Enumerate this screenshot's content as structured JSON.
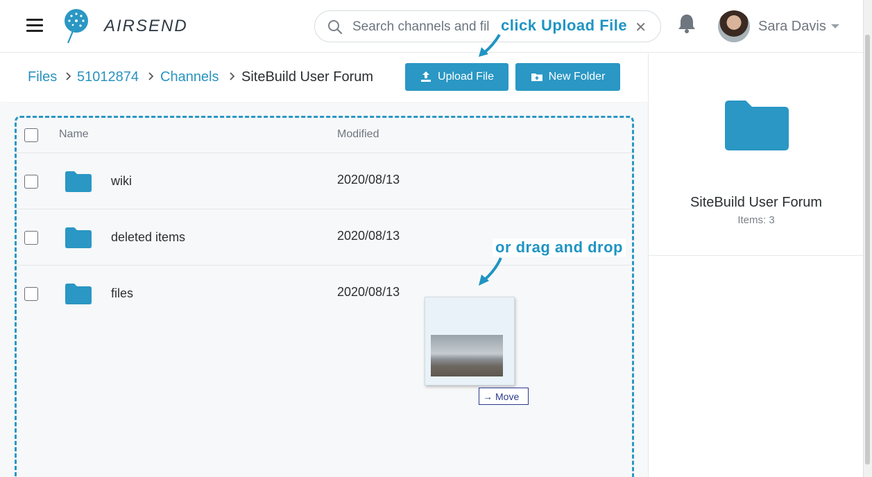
{
  "header": {
    "brand": "AIRSEND",
    "search_placeholder": "Search channels and fil",
    "user_name": "Sara Davis"
  },
  "toolbar": {
    "breadcrumbs": [
      "Files",
      "51012874",
      "Channels",
      "SiteBuild User Forum"
    ],
    "upload_label": "Upload File",
    "new_folder_label": "New Folder"
  },
  "table": {
    "columns": {
      "name": "Name",
      "modified": "Modified"
    },
    "rows": [
      {
        "name": "wiki",
        "modified": "2020/08/13",
        "type": "folder"
      },
      {
        "name": "deleted items",
        "modified": "2020/08/13",
        "type": "folder"
      },
      {
        "name": "files",
        "modified": "2020/08/13",
        "type": "folder"
      }
    ]
  },
  "annotations": {
    "upload_hint": "click Upload File",
    "drag_hint": "or drag and drop",
    "drag_tooltip": "Move"
  },
  "side_panel": {
    "title": "SiteBuild User Forum",
    "items_text": "Items: 3"
  },
  "colors": {
    "accent": "#2a97c4",
    "annotation": "#1f94c3",
    "text": "#2b2f33"
  },
  "icons": [
    "menu-icon",
    "airsend-logo-icon",
    "search-icon",
    "close-icon",
    "bell-icon",
    "avatar",
    "chevron-down-icon",
    "chevron-right-icon",
    "upload-icon",
    "folder-add-icon",
    "folder-icon",
    "arrow-right-icon"
  ]
}
